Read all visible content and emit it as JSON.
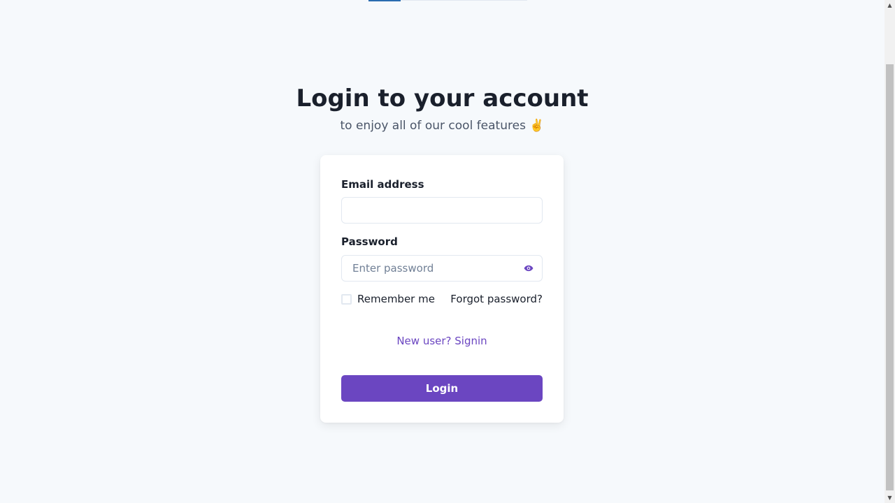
{
  "header": {
    "title": "Login to your account",
    "subtitle": "to enjoy all of our cool features ✌️"
  },
  "form": {
    "email_label": "Email address",
    "email_value": "",
    "password_label": "Password",
    "password_placeholder": "Enter password",
    "password_value": "",
    "remember_label": "Remember me",
    "remember_checked": false,
    "forgot_label": "Forgot password?",
    "signin_link": "New user? Signin",
    "login_button": "Login"
  },
  "icons": {
    "password_toggle": "eye-icon",
    "scroll_up": "scroll-up-arrow-icon",
    "scroll_down": "scroll-down-arrow-icon"
  },
  "colors": {
    "accent": "#6b46c1",
    "background": "#f6f9fc",
    "card": "#ffffff",
    "text": "#1a202c",
    "muted": "#4a5568",
    "progress": "#2b6cb0"
  }
}
